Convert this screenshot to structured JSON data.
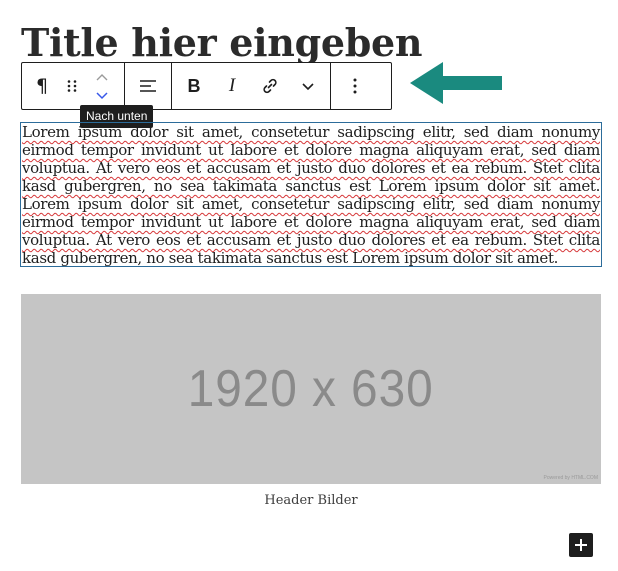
{
  "post": {
    "title": "Title hier eingeben"
  },
  "toolbar": {
    "items": [
      {
        "name": "paragraph-block-type",
        "icon": "pilcrow-icon"
      },
      {
        "name": "drag-handle",
        "icon": "drag-handle-icon"
      },
      {
        "name": "move-up",
        "icon": "chevron-up-icon"
      },
      {
        "name": "move-down",
        "icon": "chevron-down-icon"
      },
      {
        "name": "align",
        "icon": "align-left-icon"
      },
      {
        "name": "bold",
        "icon": "bold-icon"
      },
      {
        "name": "italic",
        "icon": "italic-icon"
      },
      {
        "name": "link",
        "icon": "link-icon"
      },
      {
        "name": "more-rich-text",
        "icon": "chevron-down-icon"
      },
      {
        "name": "options",
        "icon": "more-vertical-icon"
      }
    ],
    "tooltip": "Nach unten"
  },
  "annotation": {
    "icon": "arrow-left-icon",
    "color": "#1a8a7f"
  },
  "paragraph": {
    "text": "Lorem ipsum dolor sit amet, consetetur sadipscing elitr, sed diam nonumy eirmod tempor invidunt ut labore et dolore magna aliquyam erat, sed diam voluptua. At vero eos et accusam et justo duo dolores et ea rebum. Stet clita kasd gubergren, no sea takimata sanctus est Lorem ipsum dolor sit amet. Lorem ipsum dolor sit amet, consetetur sadipscing elitr, sed diam nonumy eirmod tempor invidunt ut labore et dolore magna aliquyam erat, sed diam voluptua. At vero eos et accusam et justo duo dolores et ea rebum. Stet clita kasd gubergren, no sea takimata sanctus est Lorem ipsum dolor sit amet."
  },
  "image": {
    "placeholder_text": "1920 x 630",
    "credit": "Powered by HTML.COM",
    "background": "#c5c5c5"
  },
  "caption": "Header Bilder",
  "inserter": {
    "icon": "plus-icon"
  },
  "colors": {
    "selection_border": "#2c6c9a",
    "accent": "#3858e9",
    "spellcheck": "#d63638"
  }
}
